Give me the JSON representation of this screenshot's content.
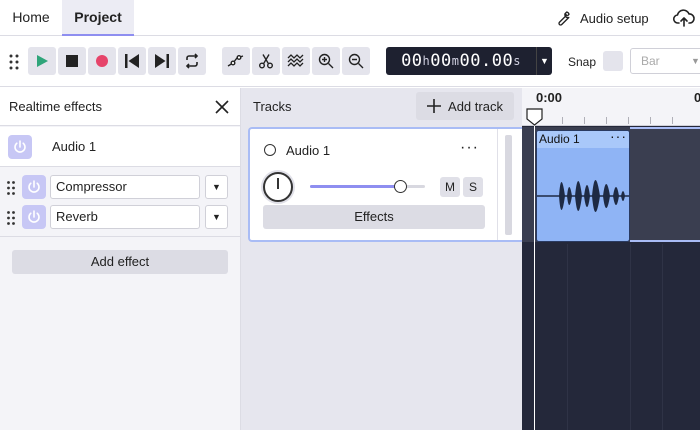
{
  "topnav": {
    "tabs": [
      {
        "label": "Home"
      },
      {
        "label": "Project",
        "active": true
      }
    ],
    "audio_setup_label": "Audio setup"
  },
  "toolbar": {
    "buttons": [
      "play-icon",
      "stop-icon",
      "record-icon",
      "skip-back-icon",
      "skip-forward-icon",
      "loop-icon",
      "envelope-icon",
      "cut-icon",
      "spectral-icon",
      "zoom-in-icon",
      "zoom-out-icon"
    ],
    "timecode": {
      "h": "00",
      "m": "00",
      "s": "00.00",
      "h_unit": "h",
      "m_unit": "m",
      "s_unit": "s"
    },
    "snap_label": "Snap",
    "snap_value": "Bar"
  },
  "effects_panel": {
    "title": "Realtime effects",
    "track_name": "Audio 1",
    "effects": [
      {
        "name": "Compressor"
      },
      {
        "name": "Reverb"
      }
    ],
    "add_effect_label": "Add effect"
  },
  "tracks": {
    "label": "Tracks",
    "add_track_label": "Add track",
    "items": [
      {
        "name": "Audio 1",
        "volume": 0.78,
        "mute_label": "M",
        "solo_label": "S",
        "effects_label": "Effects"
      }
    ]
  },
  "timeline": {
    "ruler_labels": [
      "0:00",
      "0"
    ],
    "clips": [
      {
        "title": "Audio 1"
      }
    ]
  },
  "colors": {
    "accent": "#8e8ef0",
    "play_green": "#2fa57a",
    "record_red": "#e6446a",
    "timecode_bg": "#1e2130",
    "clip_blue": "#8fb4f5",
    "timeline_bg": "#24283a"
  }
}
